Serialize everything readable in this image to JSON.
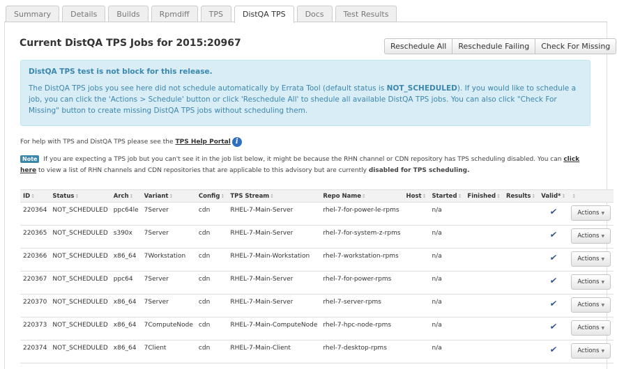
{
  "tabs": [
    {
      "label": "Summary",
      "active": false
    },
    {
      "label": "Details",
      "active": false
    },
    {
      "label": "Builds",
      "active": false
    },
    {
      "label": "Rpmdiff",
      "active": false
    },
    {
      "label": "TPS",
      "active": false
    },
    {
      "label": "DistQA TPS",
      "active": true
    },
    {
      "label": "Docs",
      "active": false
    },
    {
      "label": "Test Results",
      "active": false
    }
  ],
  "page": {
    "title": "Current DistQA TPS Jobs for 2015:20967",
    "buttons": {
      "reschedule_all": "Reschedule All",
      "reschedule_failing": "Reschedule Failing",
      "check_missing": "Check For Missing"
    }
  },
  "alert": {
    "heading": "DistQA TPS test is not block for this release.",
    "body_pre": "The DistQA TPS jobs you see here did not schedule automatically by Errata Tool (default status is ",
    "body_status": "NOT_SCHEDULED",
    "body_post": "). If you would like to schedule a job, you can click the 'Actions > Schedule' button or click 'Reschedule All' to shedule all available DistQA TPS jobs. You can also click \"Check For Missing\" button to create missing DistQA TPS jobs without scheduling them."
  },
  "help": {
    "text": "For help with TPS and DistQA TPS please see the",
    "link": "TPS Help Portal"
  },
  "note": {
    "badge": "Note",
    "text1": "If you are expecting a TPS job but you can't see it in the job list below, it might be because the RHN channel or CDN repository has TPS scheduling disabled. You can",
    "link": "click here",
    "text2": "to view a list of RHN channels and CDN repositories that are applicable to this advisory but are currently",
    "bold": "disabled for TPS scheduling."
  },
  "table": {
    "headers": [
      "ID",
      "Status",
      "Arch",
      "Variant",
      "Config",
      "TPS Stream",
      "Repo Name",
      "Host",
      "Started",
      "Finished",
      "Results",
      "Valid*",
      ""
    ],
    "action_label": "Actions",
    "rows": [
      {
        "id": "220364",
        "status": "NOT_SCHEDULED",
        "arch": "ppc64le",
        "variant": "7Server",
        "config": "cdn",
        "stream": "RHEL-7-Main-Server",
        "repo": "rhel-7-for-power-le-rpms",
        "host": "",
        "started": "n/a",
        "finished": "",
        "results": ""
      },
      {
        "id": "220365",
        "status": "NOT_SCHEDULED",
        "arch": "s390x",
        "variant": "7Server",
        "config": "cdn",
        "stream": "RHEL-7-Main-Server",
        "repo": "rhel-7-for-system-z-rpms",
        "host": "",
        "started": "n/a",
        "finished": "",
        "results": ""
      },
      {
        "id": "220366",
        "status": "NOT_SCHEDULED",
        "arch": "x86_64",
        "variant": "7Workstation",
        "config": "cdn",
        "stream": "RHEL-7-Main-Workstation",
        "repo": "rhel-7-workstation-rpms",
        "host": "",
        "started": "n/a",
        "finished": "",
        "results": ""
      },
      {
        "id": "220367",
        "status": "NOT_SCHEDULED",
        "arch": "ppc64",
        "variant": "7Server",
        "config": "cdn",
        "stream": "RHEL-7-Main-Server",
        "repo": "rhel-7-for-power-rpms",
        "host": "",
        "started": "n/a",
        "finished": "",
        "results": ""
      },
      {
        "id": "220370",
        "status": "NOT_SCHEDULED",
        "arch": "x86_64",
        "variant": "7Server",
        "config": "cdn",
        "stream": "RHEL-7-Main-Server",
        "repo": "rhel-7-server-rpms",
        "host": "",
        "started": "n/a",
        "finished": "",
        "results": ""
      },
      {
        "id": "220373",
        "status": "NOT_SCHEDULED",
        "arch": "x86_64",
        "variant": "7ComputeNode",
        "config": "cdn",
        "stream": "RHEL-7-Main-ComputeNode",
        "repo": "rhel-7-hpc-node-rpms",
        "host": "",
        "started": "n/a",
        "finished": "",
        "results": ""
      },
      {
        "id": "220374",
        "status": "NOT_SCHEDULED",
        "arch": "x86_64",
        "variant": "7Client",
        "config": "cdn",
        "stream": "RHEL-7-Main-Client",
        "repo": "rhel-7-desktop-rpms",
        "host": "",
        "started": "n/a",
        "finished": "",
        "results": ""
      }
    ]
  }
}
